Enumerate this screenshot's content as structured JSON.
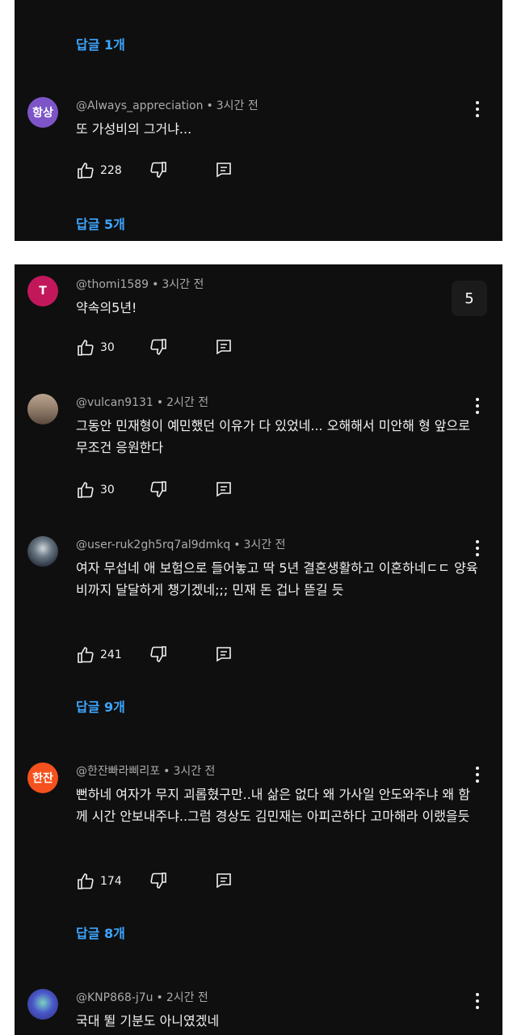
{
  "panel1": {
    "replies_top": "답글 1개",
    "comment": {
      "avatar_text": "항상",
      "avatar_color": "#7d55c7",
      "author": "@Always_appreciation",
      "time": "3시간 전",
      "text": "또 가성비의 그거냐...",
      "likes": "228",
      "replies": "답글 5개"
    }
  },
  "panel2": {
    "badge": "5",
    "comments": [
      {
        "avatar_text": "T",
        "avatar_color": "#c2185b",
        "author": "@thomi1589",
        "time": "3시간 전",
        "text": "약속의5년!",
        "likes": "30"
      },
      {
        "avatar_text": "",
        "avatar_color": "#8a7a6a",
        "author": "@vulcan9131",
        "time": "2시간 전",
        "text": "그동안 민재형이 예민했던 이유가 다 있었네... 오해해서 미안해 형 앞으로 무조건 응원한다",
        "likes": "30"
      },
      {
        "avatar_text": "",
        "avatar_color": "#3a4a55",
        "author": "@user-ruk2gh5rq7al9dmkq",
        "time": "3시간 전",
        "text": "여자 무섭네 애 보험으로 들어놓고 딱 5년 결혼생활하고 이혼하네ㄷㄷ 양육비까지 달달하게 챙기겠네;;; 민재 돈 겁나 뜯길 듯",
        "likes": "241",
        "replies": "답글 9개"
      },
      {
        "avatar_text": "한잔",
        "avatar_color": "#f4511e",
        "author": "@한잔빠라삐리포",
        "time": "3시간 전",
        "text": "뻔하네 여자가 무지 괴롭혔구만..내 삶은 없다 왜 가사일 안도와주냐 왜 함께 시간 안보내주냐..그럼 경상도 김민재는 아피곤하다 고마해라 이랬을듯",
        "likes": "174",
        "replies": "답글 8개"
      },
      {
        "avatar_text": "",
        "avatar_color": "#3b3f9e",
        "author": "@KNP868-j7u",
        "time": "2시간 전",
        "text": "국대 뛸 기분도 아니였겠네"
      }
    ]
  }
}
